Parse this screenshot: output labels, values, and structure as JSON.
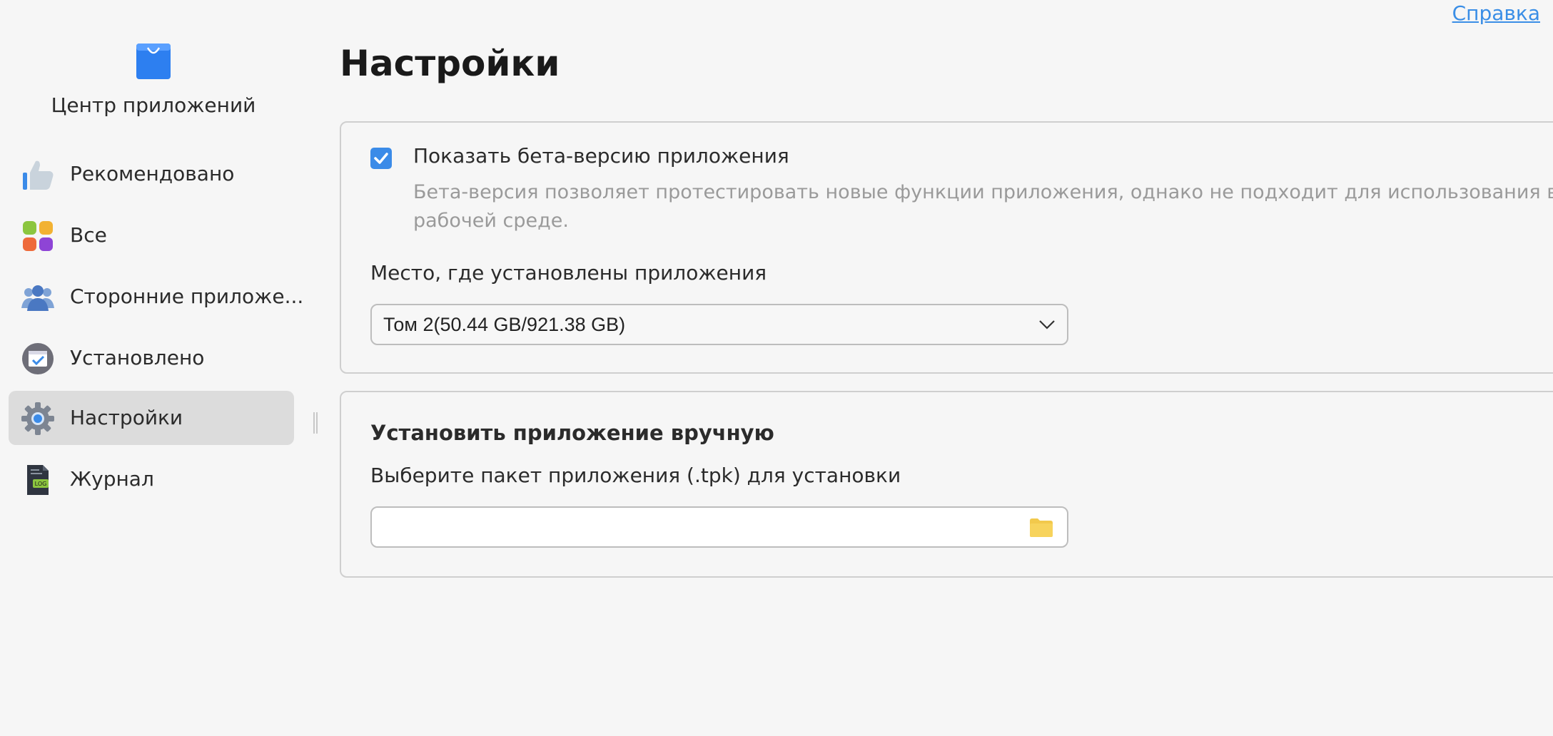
{
  "app": {
    "title": "Центр приложений"
  },
  "header": {
    "help_link": "Справка",
    "page_title": "Настройки"
  },
  "sidebar": {
    "items": [
      {
        "label": "Рекомендовано",
        "icon": "thumbs-up-icon",
        "active": false
      },
      {
        "label": "Все",
        "icon": "all-apps-grid-icon",
        "active": false
      },
      {
        "label": "Сторонние приложе...",
        "icon": "third-party-users-icon",
        "active": false
      },
      {
        "label": "Установлено",
        "icon": "installed-icon",
        "active": false
      },
      {
        "label": "Настройки",
        "icon": "gear-icon",
        "active": true
      },
      {
        "label": "Журнал",
        "icon": "log-file-icon",
        "active": false
      }
    ]
  },
  "beta": {
    "checked": true,
    "label": "Показать бета-версию приложения",
    "description": "Бета-версия позволяет протестировать новые функции приложения, однако не подходит для использования в рабочей среде."
  },
  "install_location": {
    "label": "Место, где установлены приложения",
    "selected": "Том 2(50.44 GB/921.38 GB)"
  },
  "manual_install": {
    "title": "Установить приложение вручную",
    "label": "Выберите пакет приложения (.tpk) для установки",
    "value": ""
  },
  "colors": {
    "accent": "#3b8be8",
    "link": "#3a8ee6",
    "active_nav": "#dcdcdc",
    "folder": "#f2c94c"
  }
}
